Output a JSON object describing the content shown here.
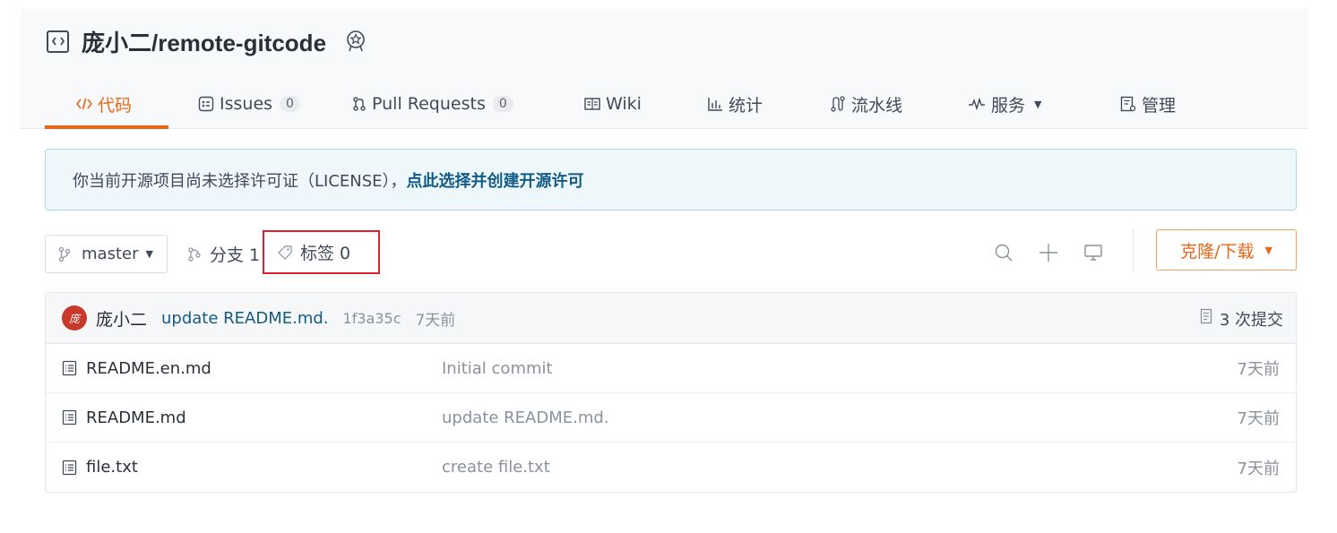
{
  "repo": {
    "owner": "庞小二",
    "name_full": "庞小二/remote-gitcode"
  },
  "tabs": [
    {
      "label": "代码",
      "icon": "code-icon",
      "active": true
    },
    {
      "label": "Issues",
      "icon": "issues-icon",
      "count": "0"
    },
    {
      "label": "Pull Requests",
      "icon": "pull-request-icon",
      "count": "0"
    },
    {
      "label": "Wiki",
      "icon": "wiki-icon"
    },
    {
      "label": "统计",
      "icon": "stats-icon"
    },
    {
      "label": "流水线",
      "icon": "pipeline-icon"
    },
    {
      "label": "服务",
      "icon": "service-icon",
      "dropdown": true
    },
    {
      "label": "管理",
      "icon": "manage-icon"
    }
  ],
  "notice": {
    "text": "你当前开源项目尚未选择许可证（LICENSE），",
    "link": "点此选择并创建开源许可"
  },
  "toolbar": {
    "branch": "master",
    "branches_label": "分支 1",
    "tags_label": "标签 0",
    "clone_label": "克隆/下载"
  },
  "commit": {
    "avatar_text": "庞",
    "author": "庞小二",
    "message": "update README.md.",
    "hash": "1f3a35c",
    "time": "7天前",
    "count_label": "3 次提交"
  },
  "files": [
    {
      "name": "README.en.md",
      "commit": "Initial commit",
      "time": "7天前"
    },
    {
      "name": "README.md",
      "commit": "update README.md.",
      "time": "7天前"
    },
    {
      "name": "file.txt",
      "commit": "create file.txt",
      "time": "7天前"
    }
  ],
  "colors": {
    "accent": "#e8661a",
    "link": "#135b87",
    "highlight_border": "#e0202c"
  }
}
